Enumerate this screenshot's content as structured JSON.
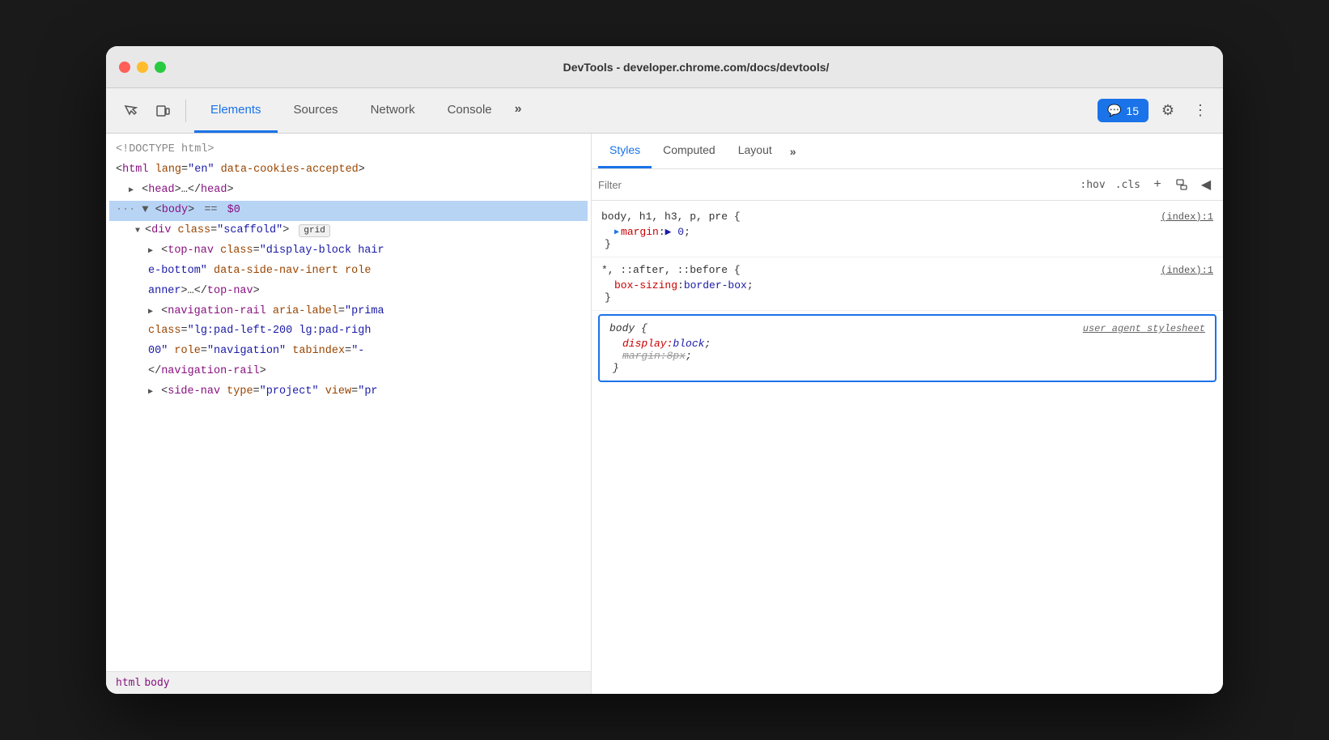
{
  "window": {
    "title": "DevTools - developer.chrome.com/docs/devtools/",
    "controls": {
      "close": "close",
      "minimize": "minimize",
      "maximize": "maximize"
    }
  },
  "toolbar": {
    "tabs": [
      {
        "label": "Elements",
        "active": true
      },
      {
        "label": "Sources",
        "active": false
      },
      {
        "label": "Network",
        "active": false
      },
      {
        "label": "Console",
        "active": false
      }
    ],
    "more_label": "»",
    "badge": {
      "icon": "💬",
      "count": "15"
    },
    "settings_label": "⚙",
    "dots_label": "⋮"
  },
  "elements_panel": {
    "code_lines": [
      {
        "text": "<!DOCTYPE html>",
        "type": "doctype",
        "indent": 0
      },
      {
        "text": "<html lang=\"en\" data-cookies-accepted>",
        "type": "tag",
        "indent": 0
      },
      {
        "text": "▶ <head>…</head>",
        "type": "collapsed",
        "indent": 1
      },
      {
        "text": "··· ▼ <body> == $0",
        "type": "selected",
        "indent": 0
      },
      {
        "text": "▼ <div class=\"scaffold\">  grid",
        "type": "tag",
        "indent": 2
      },
      {
        "text": "▶ <top-nav class=\"display-block hair",
        "type": "tag",
        "indent": 3
      },
      {
        "text": "e-bottom\" data-side-nav-inert role",
        "type": "tag-cont",
        "indent": 3
      },
      {
        "text": "anner\">…</top-nav>",
        "type": "tag-cont",
        "indent": 3
      },
      {
        "text": "▶ <navigation-rail aria-label=\"prima",
        "type": "tag",
        "indent": 3
      },
      {
        "text": "class=\"lg:pad-left-200 lg:pad-righ",
        "type": "tag-cont",
        "indent": 3
      },
      {
        "text": "00\" role=\"navigation\" tabindex=\"-",
        "type": "tag-cont",
        "indent": 3
      },
      {
        "text": "</navigation-rail>",
        "type": "close-tag",
        "indent": 3
      },
      {
        "text": "▶ <side-nav type=\"project\" view=\"pr",
        "type": "tag",
        "indent": 3
      }
    ],
    "breadcrumb": [
      "html",
      "body"
    ]
  },
  "styles_panel": {
    "tabs": [
      {
        "label": "Styles",
        "active": true
      },
      {
        "label": "Computed",
        "active": false
      },
      {
        "label": "Layout",
        "active": false
      }
    ],
    "more_label": "»",
    "filter": {
      "placeholder": "Filter",
      "hov_label": ":hov",
      "cls_label": ".cls",
      "plus_label": "+",
      "paint_label": "🖌",
      "arrow_label": "◀"
    },
    "css_rules": [
      {
        "selector": "body, h1, h3, p, pre {",
        "source": "(index):1",
        "properties": [
          {
            "name": "margin",
            "colon": ": ",
            "value": "▶ 0",
            "strikethrough": false
          }
        ],
        "close": "}",
        "highlighted": false
      },
      {
        "selector": "*, ::after, ::before {",
        "source": "(index):1",
        "properties": [
          {
            "name": "box-sizing",
            "colon": ": ",
            "value": "border-box",
            "strikethrough": false
          }
        ],
        "close": "}",
        "highlighted": false
      },
      {
        "selector": "body {",
        "source": "user agent stylesheet",
        "properties": [
          {
            "name": "display",
            "colon": ": ",
            "value": "block",
            "strikethrough": false
          },
          {
            "name": "margin",
            "colon": ": ",
            "value": "8px",
            "strikethrough": true
          }
        ],
        "close": "}",
        "highlighted": true
      }
    ]
  }
}
